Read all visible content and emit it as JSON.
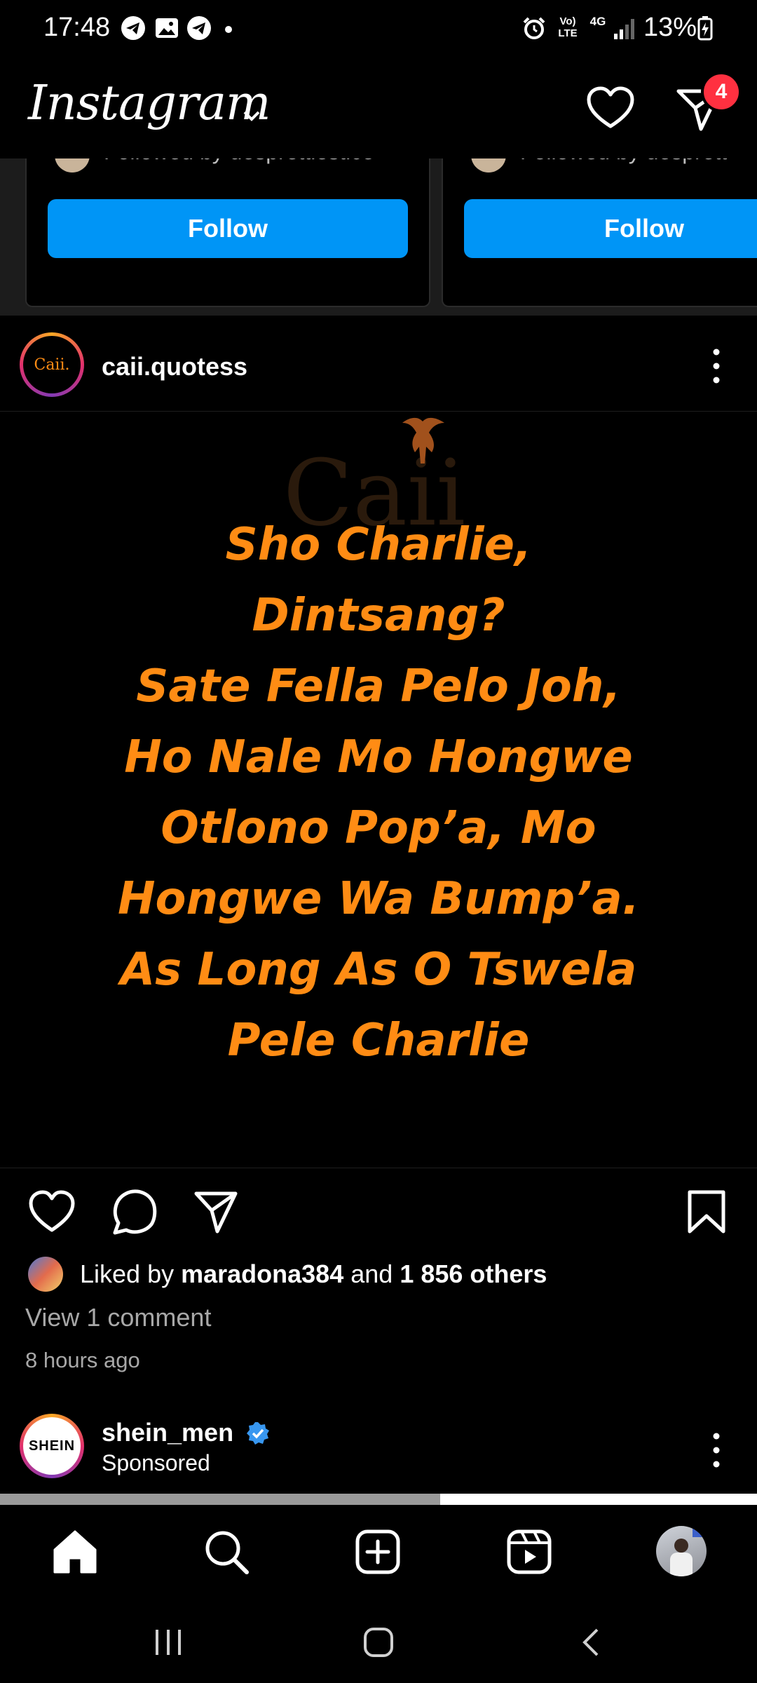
{
  "status_bar": {
    "time": "17:48",
    "battery_percent": "13%",
    "network_volte": "Vo) LTE",
    "network_type": "4G"
  },
  "header": {
    "app_title": "Instagram",
    "message_badge_count": "4"
  },
  "suggestions": {
    "cards": [
      {
        "followed_by_text": "Followed by desprettiestice",
        "follow_label": "Follow"
      },
      {
        "followed_by_text": "Followed by desprett",
        "follow_label": "Follow"
      }
    ]
  },
  "post": {
    "username": "caii.quotess",
    "avatar_text": "Caii.",
    "watermark_text": "Caii",
    "quote_lines": [
      "Sho Charlie,",
      "Dintsang?",
      "Sate Fella Pelo Joh,",
      "Ho Nale Mo Hongwe",
      "Otlono Pop’a, Mo",
      "Hongwe Wa Bump’a.",
      "As Long As O Tswela",
      "Pele Charlie"
    ],
    "liked_by_prefix": "Liked by",
    "liked_by_user": "maradona384",
    "liked_by_and": "and",
    "liked_by_others": "1 856 others",
    "view_comments": "View 1 comment",
    "time_ago": "8 hours ago"
  },
  "sponsored_post": {
    "username": "shein_men",
    "sponsored_label": "Sponsored",
    "avatar_text": "SHEIN",
    "verified": true
  },
  "colors": {
    "accent_blue": "#0095f6",
    "quote_orange": "#ff8c14",
    "badge_red": "#ff3040",
    "verified_blue": "#3897f0"
  },
  "icons": {
    "bottom_nav": [
      "home-icon",
      "search-icon",
      "create-icon",
      "reels-icon",
      "profile-avatar"
    ],
    "post_actions": [
      "like-icon",
      "comment-icon",
      "share-icon",
      "save-icon"
    ]
  }
}
